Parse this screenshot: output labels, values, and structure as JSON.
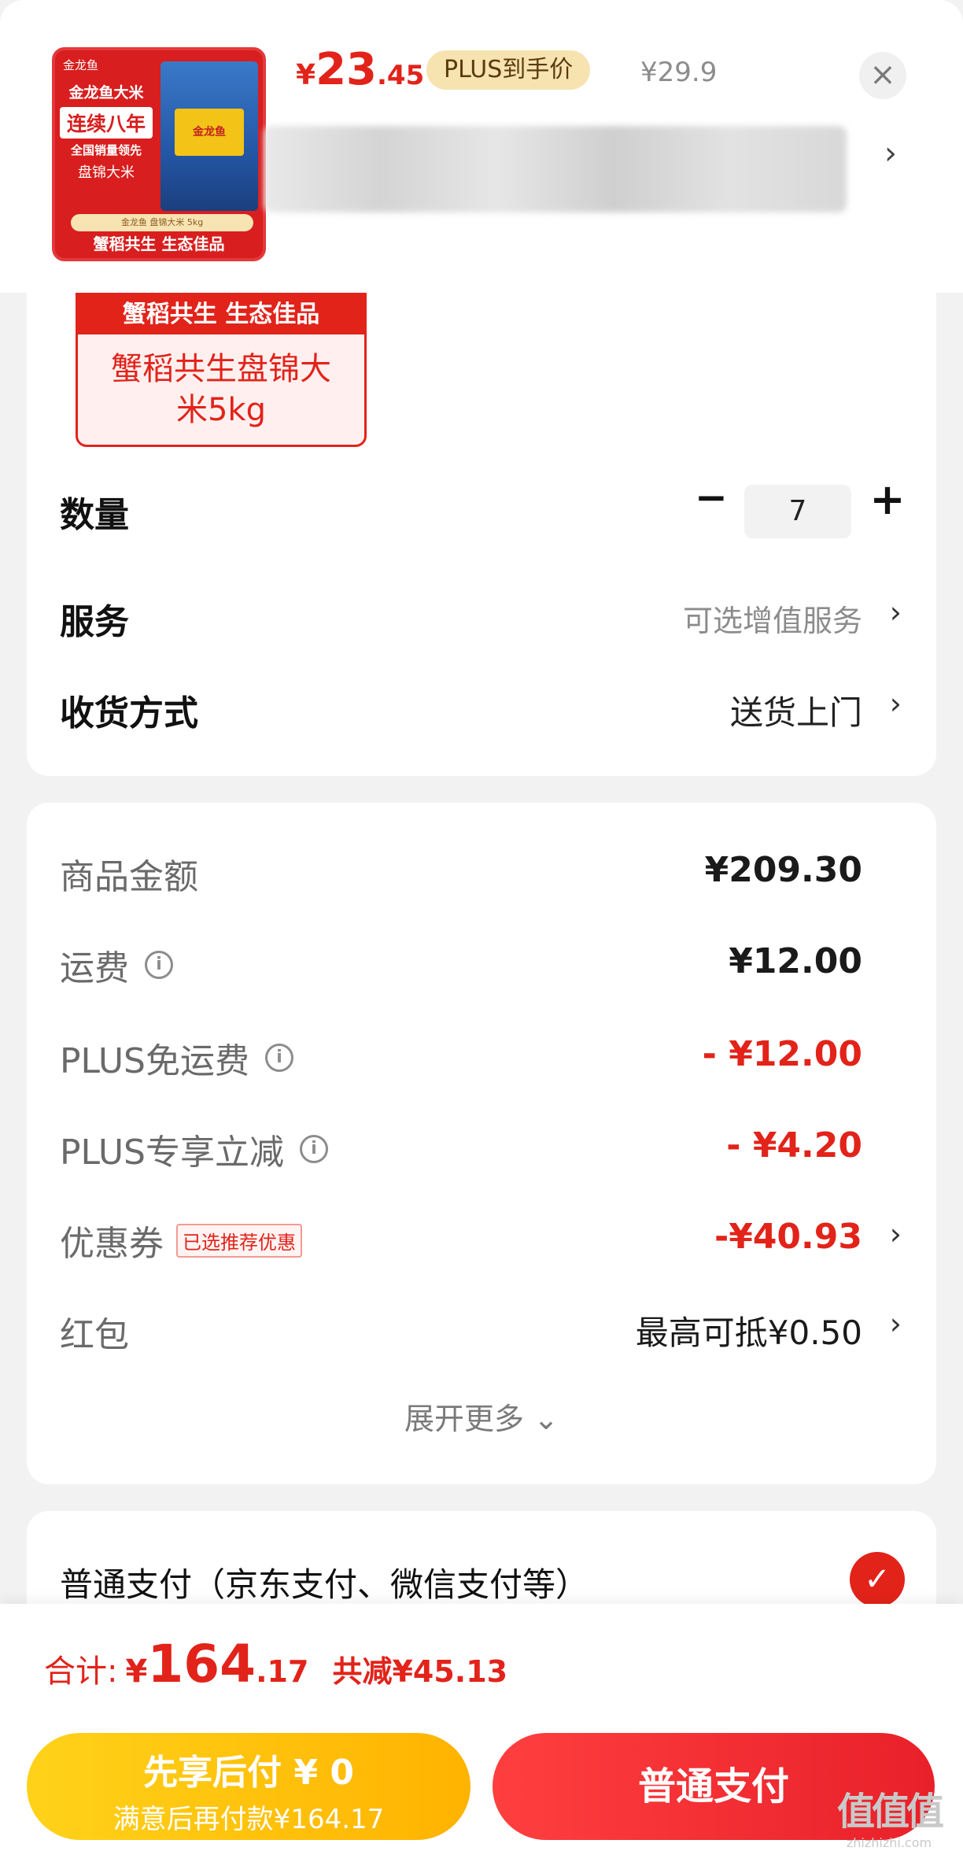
{
  "product": {
    "image": {
      "brand": "金龙鱼",
      "line1": "金龙鱼大米",
      "line2": "连续八年",
      "line3": "全国销量领先",
      "line4": "盘锦大米",
      "bag_label": "金龙鱼",
      "strip": "金龙鱼 盘锦大米 5kg",
      "footer": "蟹稻共生 生态佳品"
    },
    "price_symbol": "¥",
    "price_int": "23",
    "price_dec": ".45",
    "plus_badge": "PLUS到手价",
    "original_price": "¥29.9",
    "close_icon": "×",
    "title_chevron": "›"
  },
  "options": {
    "spec": {
      "header": "蟹稻共生 生态佳品",
      "name": "蟹稻共生盘锦大米5kg"
    },
    "quantity": {
      "label": "数量",
      "minus": "−",
      "value": "7",
      "plus": "+"
    },
    "service": {
      "label": "服务",
      "value": "可选增值服务",
      "chevron": "›"
    },
    "delivery": {
      "label": "收货方式",
      "value": "送货上门",
      "chevron": "›"
    }
  },
  "fees": {
    "subtotal": {
      "label": "商品金额",
      "value": "¥209.30"
    },
    "shipping": {
      "label": "运费",
      "info_icon": "i",
      "value": "¥12.00"
    },
    "plus_free_shipping": {
      "label": "PLUS免运费",
      "info_icon": "i",
      "value": "- ¥12.00"
    },
    "plus_discount": {
      "label": "PLUS专享立减",
      "info_icon": "i",
      "value": "- ¥4.20"
    },
    "coupon": {
      "label": "优惠券",
      "tag": "已选推荐优惠",
      "value": "-¥40.93",
      "chevron": "›"
    },
    "red_packet": {
      "label": "红包",
      "value": "最高可抵¥0.50",
      "chevron": "›"
    },
    "expand_more": "展开更多 ⌄"
  },
  "payment": {
    "method_label": "普通支付（京东支付、微信支付等）",
    "check_icon": "✓"
  },
  "summary": {
    "total_label": "合计:",
    "total_symbol": "¥",
    "total_int": "164",
    "total_dec": ".17",
    "total_saved": "共减¥45.13"
  },
  "buttons": {
    "pay_later_main": "先享后付 ¥ 0",
    "pay_later_sub": "满意后再付款¥164.17",
    "pay_now": "普通支付"
  },
  "watermark": {
    "main": "值值值",
    "sub": "zhizhizhi.com"
  },
  "colors": {
    "accent": "#e2231a",
    "gold": "#ffb300",
    "plus_badge": "#f6e3b0"
  }
}
